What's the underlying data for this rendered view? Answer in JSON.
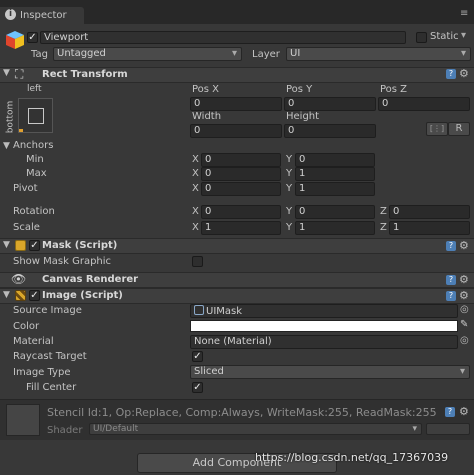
{
  "tab": {
    "title": "Inspector"
  },
  "object": {
    "active": true,
    "name": "Viewport",
    "static_label": "Static",
    "tag_label": "Tag",
    "tag_value": "Untagged",
    "layer_label": "Layer",
    "layer_value": "UI"
  },
  "rect_transform": {
    "title": "Rect Transform",
    "anchor_preset_top": "left",
    "anchor_preset_side": "bottom",
    "pos_x_label": "Pos X",
    "pos_y_label": "Pos Y",
    "pos_z_label": "Pos Z",
    "pos_x": "0",
    "pos_y": "0",
    "pos_z": "0",
    "width_label": "Width",
    "height_label": "Height",
    "width": "0",
    "height": "0",
    "r_button": "R",
    "anchors_label": "Anchors",
    "min_label": "Min",
    "max_label": "Max",
    "min_x": "0",
    "min_y": "0",
    "max_x": "0",
    "max_y": "1",
    "pivot_label": "Pivot",
    "pivot_x": "0",
    "pivot_y": "1",
    "rotation_label": "Rotation",
    "rot_x": "0",
    "rot_y": "0",
    "rot_z": "0",
    "scale_label": "Scale",
    "scale_x": "1",
    "scale_y": "1",
    "scale_z": "1",
    "x": "X",
    "y": "Y",
    "z": "Z"
  },
  "mask": {
    "title": "Mask (Script)",
    "show_graphic_label": "Show Mask Graphic",
    "show_graphic": false
  },
  "canvas_renderer": {
    "title": "Canvas Renderer"
  },
  "image": {
    "title": "Image (Script)",
    "source_image_label": "Source Image",
    "source_image": "UIMask",
    "color_label": "Color",
    "color_value": "#ffffff",
    "material_label": "Material",
    "material": "None (Material)",
    "raycast_label": "Raycast Target",
    "raycast": true,
    "image_type_label": "Image Type",
    "image_type": "Sliced",
    "fill_center_label": "Fill Center",
    "fill_center": true
  },
  "material_preview": {
    "stencil": "Stencil Id:1, Op:Replace, Comp:Always, WriteMask:255, ReadMask:255",
    "shader_label": "Shader",
    "shader_value": "UI/Default"
  },
  "add_component": "Add Component",
  "watermark": "https://blog.csdn.net/qq_17367039"
}
